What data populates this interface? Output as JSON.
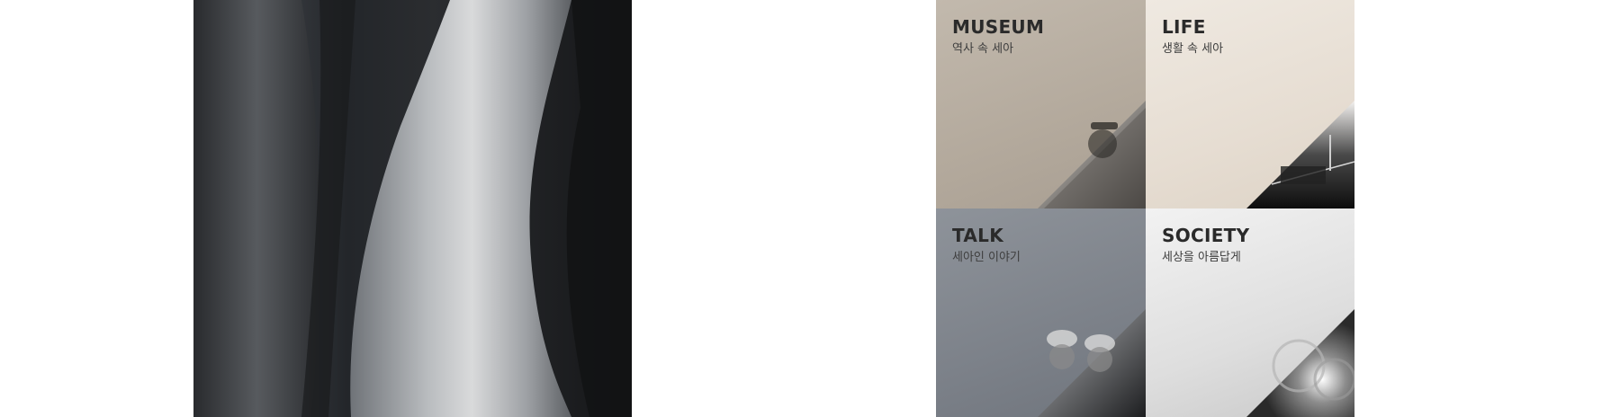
{
  "hero": {
    "image": "steel-coil-photo"
  },
  "tiles": [
    {
      "key": "museum",
      "title": "MUSEUM",
      "subtitle": "역사 속 세아",
      "image": "worker-illustration"
    },
    {
      "key": "life",
      "title": "LIFE",
      "subtitle": "생활 속 세아",
      "image": "night-bridge-photo"
    },
    {
      "key": "talk",
      "title": "TALK",
      "subtitle": "세아인 이야기",
      "image": "two-workers-photo"
    },
    {
      "key": "society",
      "title": "SOCIETY",
      "subtitle": "세상을 아름답게",
      "image": "worker-with-pipes-photo"
    }
  ]
}
